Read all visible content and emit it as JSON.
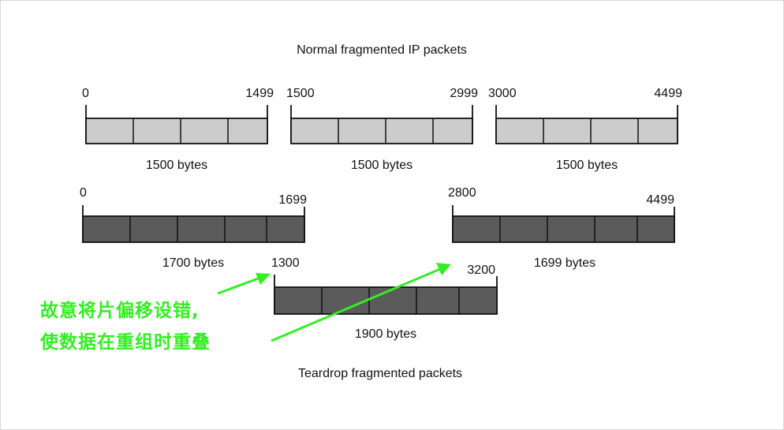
{
  "normal_title": "Normal fragmented IP packets",
  "teardrop_title": "Teardrop fragmented packets",
  "colors": {
    "light_fill": "#cccccc",
    "dark_fill": "#5b5b5b",
    "stroke": "#111111",
    "annotation_green": "#33ee22",
    "page_border": "#d6d6d6"
  },
  "normal_packets": [
    {
      "start": "0",
      "end": "1499",
      "size": "1500 bytes"
    },
    {
      "start": "1500",
      "end": "2999",
      "size": "1500 bytes"
    },
    {
      "start": "3000",
      "end": "4499",
      "size": "1500 bytes"
    }
  ],
  "teardrop_packets": [
    {
      "start": "0",
      "end": "1699",
      "size": "1700 bytes"
    },
    {
      "start": "2800",
      "end": "4499",
      "size": "1699 bytes"
    },
    {
      "start": "1300",
      "end": "3200",
      "size": "1900 bytes"
    }
  ],
  "annotation": {
    "line1": "故意将片偏移设错,",
    "line2": "使数据在重组时重叠"
  }
}
